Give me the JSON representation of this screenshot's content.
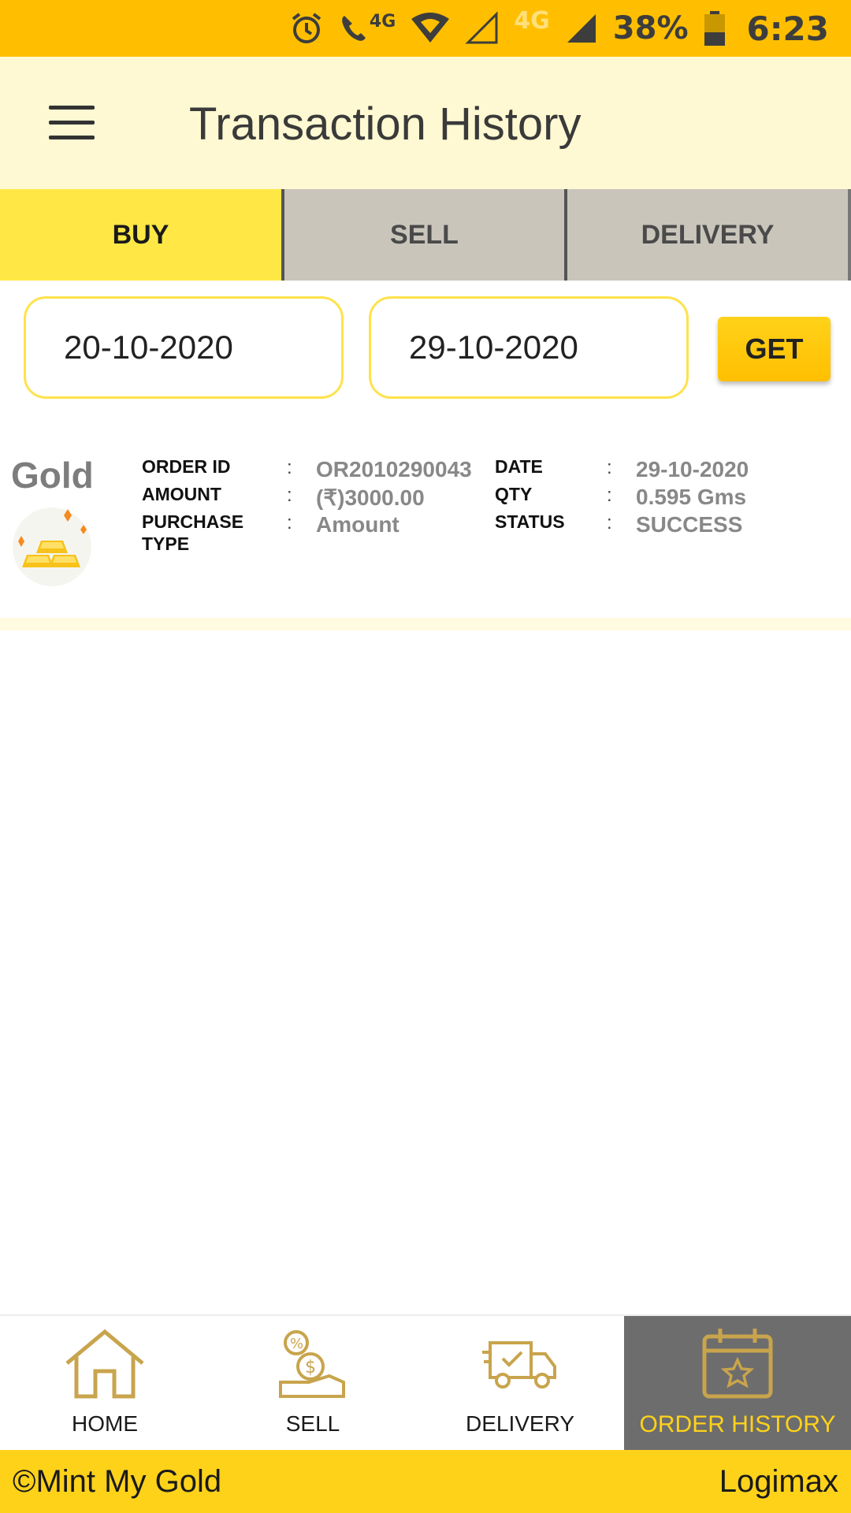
{
  "status_bar": {
    "network_small_1": "4G",
    "network_small_2": "4G",
    "battery": "38%",
    "time": "6:23"
  },
  "header": {
    "title": "Transaction History"
  },
  "tabs": [
    {
      "label": "BUY",
      "active": true
    },
    {
      "label": "SELL",
      "active": false
    },
    {
      "label": "DELIVERY",
      "active": false
    }
  ],
  "filter": {
    "from_date": "20-10-2020",
    "to_date": "29-10-2020",
    "get_label": "GET"
  },
  "transaction": {
    "metal": "Gold",
    "left_fields": [
      {
        "label": "ORDER ID",
        "value": "OR2010290043"
      },
      {
        "label": "AMOUNT",
        "value": "(₹)3000.00"
      },
      {
        "label": "PURCHASE TYPE",
        "value": "Amount"
      }
    ],
    "right_fields": [
      {
        "label": "DATE",
        "value": "29-10-2020"
      },
      {
        "label": "QTY",
        "value": "0.595 Gms"
      },
      {
        "label": "STATUS",
        "value": "SUCCESS"
      }
    ],
    "colon": ":"
  },
  "bottom_nav": [
    {
      "label": "HOME",
      "icon": "home-icon"
    },
    {
      "label": "SELL",
      "icon": "sell-icon"
    },
    {
      "label": "DELIVERY",
      "icon": "delivery-truck-icon"
    },
    {
      "label": "ORDER HISTORY",
      "icon": "calendar-star-icon",
      "active": true
    }
  ],
  "footer": {
    "left": "©Mint My Gold",
    "right": "Logimax"
  },
  "colors": {
    "status_bar": "#ffbf00",
    "app_bar": "#fef9d2",
    "active_tab": "#ffe845",
    "inactive_tab": "#c9c5bb",
    "nav_icon": "#c8a44c",
    "footer": "#ffd21a"
  }
}
